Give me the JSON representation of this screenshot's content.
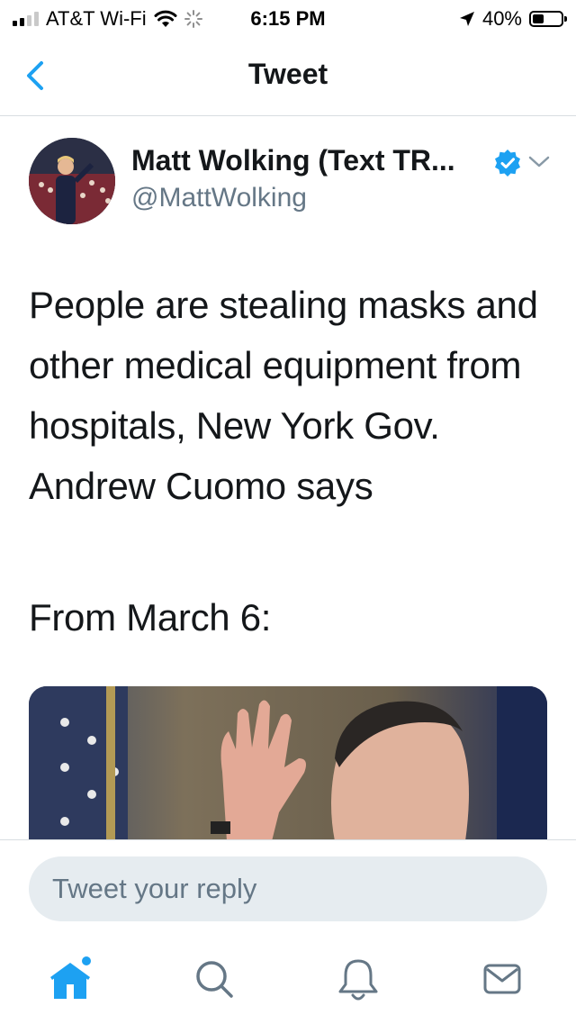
{
  "status_bar": {
    "carrier": "AT&T Wi-Fi",
    "time": "6:15 PM",
    "battery": "40%",
    "battery_level": 0.4
  },
  "nav": {
    "title": "Tweet",
    "back_icon": "chevron-left-icon"
  },
  "tweet": {
    "author_name": "Matt Wolking (Text TR...",
    "author_handle": "@MattWolking",
    "verified": true,
    "text": "People are stealing masks and other medical equipment from hospitals, New York Gov. Andrew Cuomo says",
    "text_secondary": "From March 6:"
  },
  "reply": {
    "placeholder": "Tweet your reply"
  },
  "tabbar": {
    "items": [
      "home-icon",
      "search-icon",
      "notifications-icon",
      "messages-icon"
    ]
  },
  "colors": {
    "accent": "#1da1f2",
    "secondary_text": "#657786",
    "divider": "#d8dde1",
    "reply_bg": "#e6ecf0"
  }
}
